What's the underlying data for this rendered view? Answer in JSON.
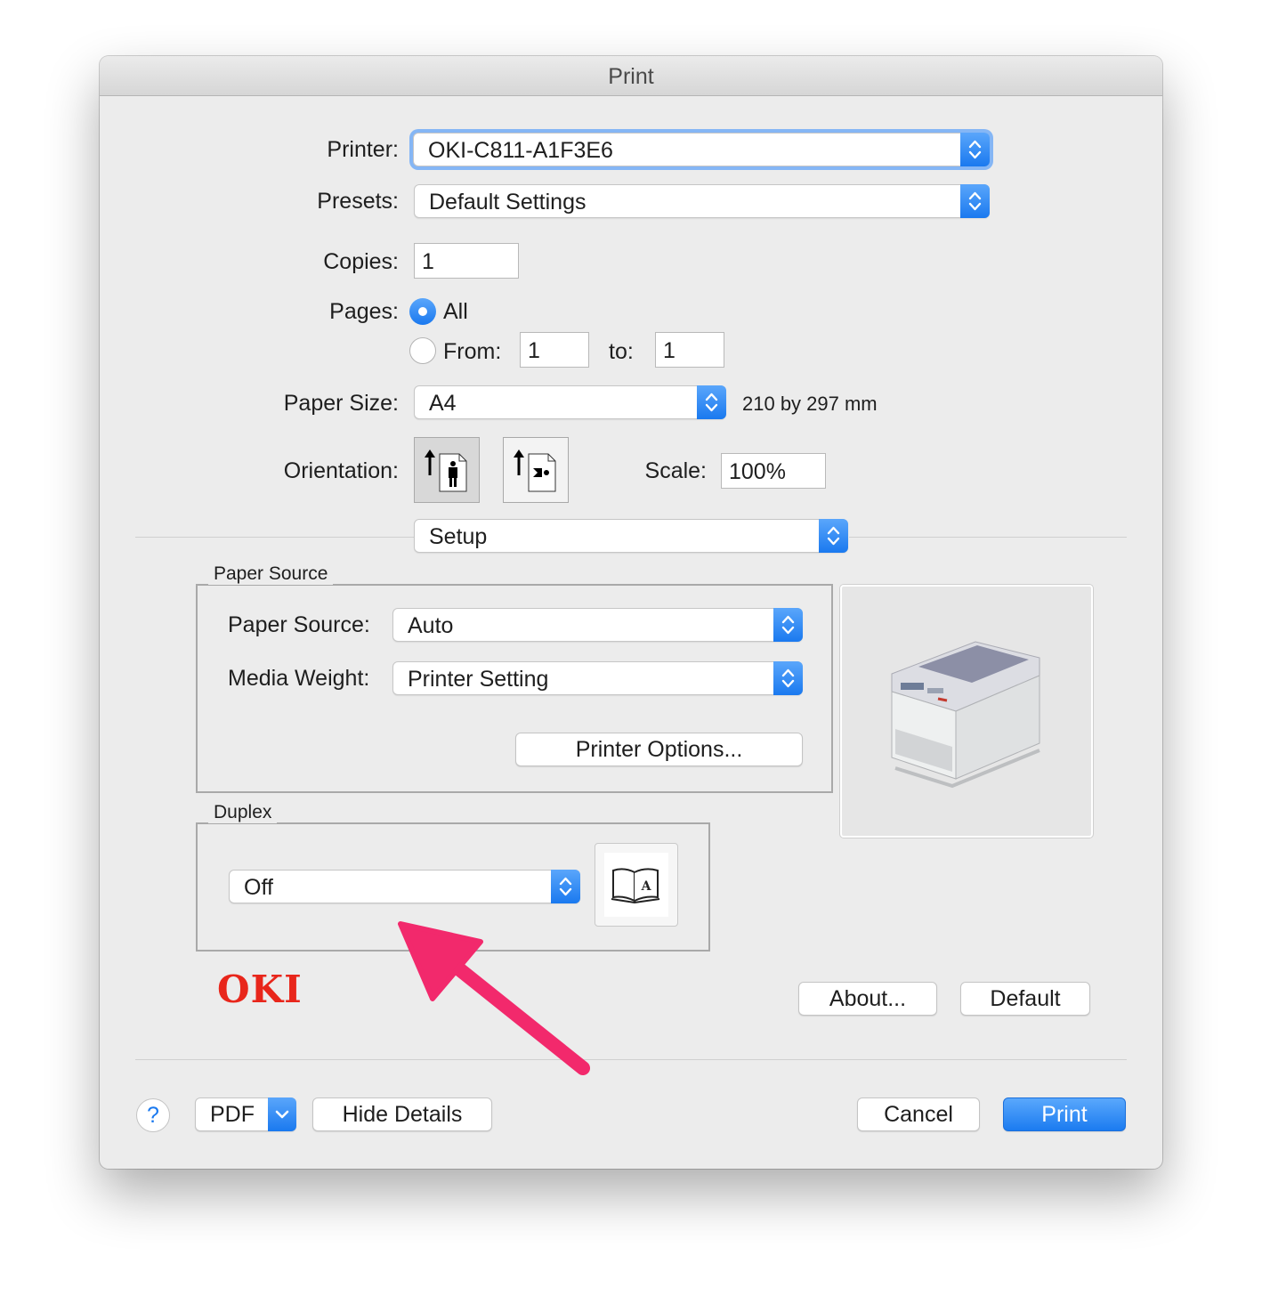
{
  "window": {
    "title": "Print"
  },
  "printer": {
    "label": "Printer:",
    "value": "OKI-C811-A1F3E6"
  },
  "presets": {
    "label": "Presets:",
    "value": "Default Settings"
  },
  "copies": {
    "label": "Copies:",
    "value": "1"
  },
  "pages": {
    "label": "Pages:",
    "all_label": "All",
    "from_label": "From:",
    "from_value": "1",
    "to_label": "to:",
    "to_value": "1",
    "selected": "All"
  },
  "paper_size": {
    "label": "Paper Size:",
    "value": "A4",
    "dimensions": "210 by 297 mm"
  },
  "orientation": {
    "label": "Orientation:",
    "selected": "portrait"
  },
  "scale": {
    "label": "Scale:",
    "value": "100%"
  },
  "section": {
    "value": "Setup"
  },
  "paper_source_group": {
    "title": "Paper Source",
    "source_label": "Paper Source:",
    "source_value": "Auto",
    "weight_label": "Media Weight:",
    "weight_value": "Printer Setting",
    "options_button": "Printer Options..."
  },
  "duplex_group": {
    "title": "Duplex",
    "value": "Off"
  },
  "brand": {
    "logo_text": "OKI",
    "logo_color": "#e8261b"
  },
  "buttons": {
    "about": "About...",
    "default": "Default",
    "help": "?",
    "pdf": "PDF",
    "hide_details": "Hide Details",
    "cancel": "Cancel",
    "print": "Print"
  },
  "colors": {
    "accent": "#1a79ef",
    "annotation_arrow": "#f2296c"
  }
}
